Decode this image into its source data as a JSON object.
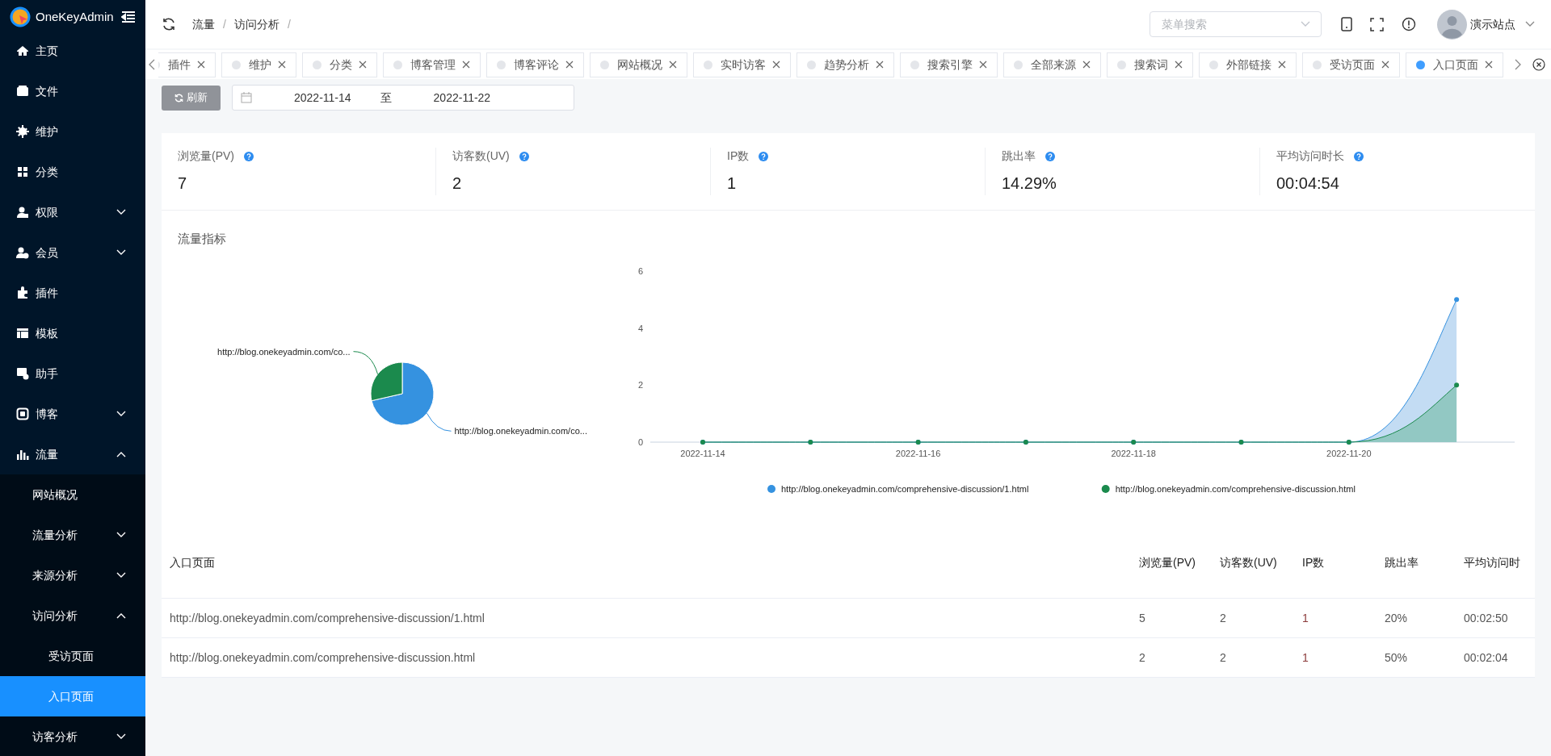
{
  "sidebar": {
    "logo": "OneKeyAdmin",
    "items": [
      {
        "label": "主页",
        "selected": false
      },
      {
        "label": "文件",
        "selected": false
      },
      {
        "label": "维护",
        "selected": false
      },
      {
        "label": "分类",
        "selected": false
      },
      {
        "label": "权限",
        "selected": false,
        "expanded": false
      },
      {
        "label": "会员",
        "selected": false,
        "expanded": false
      },
      {
        "label": "插件",
        "selected": false
      },
      {
        "label": "模板",
        "selected": false
      },
      {
        "label": "助手",
        "selected": false
      },
      {
        "label": "博客",
        "selected": false,
        "expanded": false
      },
      {
        "label": "流量",
        "selected": false,
        "expanded": true,
        "children": [
          {
            "label": "网站概况",
            "selected": false
          },
          {
            "label": "流量分析",
            "selected": false,
            "expanded": false
          },
          {
            "label": "来源分析",
            "selected": false,
            "expanded": false
          },
          {
            "label": "访问分析",
            "selected": false,
            "expanded": true,
            "children": [
              {
                "label": "受访页面",
                "selected": false
              },
              {
                "label": "入口页面",
                "selected": true
              }
            ]
          },
          {
            "label": "访客分析",
            "selected": false,
            "expanded": false
          }
        ]
      }
    ]
  },
  "header": {
    "breadcrumb": [
      "流量",
      "访问分析"
    ],
    "breadcrumb_separator": "/",
    "search": {
      "placeholder": "菜单搜索"
    },
    "user": "演示站点"
  },
  "tabs": [
    {
      "label": "插件",
      "selected": false
    },
    {
      "label": "维护",
      "selected": false
    },
    {
      "label": "分类",
      "selected": false
    },
    {
      "label": "博客管理",
      "selected": false
    },
    {
      "label": "博客评论",
      "selected": false
    },
    {
      "label": "网站概况",
      "selected": false
    },
    {
      "label": "实时访客",
      "selected": false
    },
    {
      "label": "趋势分析",
      "selected": false
    },
    {
      "label": "搜索引擎",
      "selected": false
    },
    {
      "label": "全部来源",
      "selected": false
    },
    {
      "label": "搜索词",
      "selected": false
    },
    {
      "label": "外部链接",
      "selected": false
    },
    {
      "label": "受访页面",
      "selected": false
    },
    {
      "label": "入口页面",
      "selected": true
    }
  ],
  "toolbar": {
    "refresh_button": "刷新",
    "date_range": {
      "start": "2022-11-14",
      "separator": "至",
      "end": "2022-11-22"
    }
  },
  "stats": [
    {
      "label": "浏览量(PV)",
      "value": "7"
    },
    {
      "label": "访客数(UV)",
      "value": "2"
    },
    {
      "label": "IP数",
      "value": "1"
    },
    {
      "label": "跳出率",
      "value": "14.29%"
    },
    {
      "label": "平均访问时长",
      "value": "00:04:54"
    }
  ],
  "traffic_card": {
    "title": "流量指标",
    "pie": {
      "chart_data": {
        "type": "pie",
        "categories": [
          "http://blog.onekeyadmin.com/co...",
          "http://blog.onekeyadmin.com/co..."
        ],
        "values": [
          71.43,
          28.57
        ],
        "colors": [
          "#3592e0",
          "#1b8a4d"
        ]
      }
    },
    "line": {
      "chart_data": {
        "type": "area",
        "categories": [
          "2022-11-14",
          null,
          "2022-11-16",
          null,
          "2022-11-18",
          null,
          "2022-11-20",
          null
        ],
        "legend": true,
        "yticks": [
          0,
          2,
          4,
          6
        ],
        "ylim": [
          0,
          6
        ],
        "series": [
          {
            "name": "http://blog.onekeyadmin.com/comprehensive-discussion/1.html",
            "color": "#3592e0",
            "values": [
              0,
              0,
              0,
              0,
              0,
              0,
              0,
              5
            ]
          },
          {
            "name": "http://blog.onekeyadmin.com/comprehensive-discussion.html",
            "color": "#1b8a4d",
            "values": [
              0,
              0,
              0,
              0,
              0,
              0,
              0,
              2
            ]
          }
        ]
      }
    }
  },
  "table": {
    "columns": [
      "入口页面",
      "浏览量(PV)",
      "访客数(UV)",
      "IP数",
      "跳出率",
      "平均访问时"
    ],
    "rows": [
      [
        "http://blog.onekeyadmin.com/comprehensive-discussion/1.html",
        "5",
        "2",
        "1",
        "20%",
        "00:02:50"
      ],
      [
        "http://blog.onekeyadmin.com/comprehensive-discussion.html",
        "2",
        "2",
        "1",
        "50%",
        "00:02:04"
      ]
    ]
  }
}
